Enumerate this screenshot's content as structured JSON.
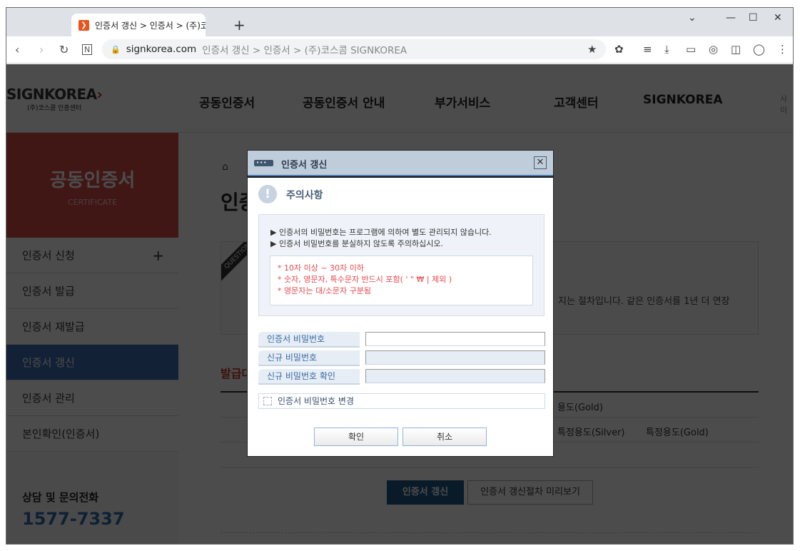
{
  "browser": {
    "tab_title": "인증서 갱신 > 인증서 > (주)코스콤 SIGNKOREA",
    "new_tab": "+",
    "domain": "signkorea.com",
    "path": "인증서 갱신 > 인증서 > (주)코스콤 SIGNKOREA"
  },
  "header": {
    "logo": "SIGNKOREA",
    "logo_sub": "(주)코스콤 인증센터",
    "nav": [
      "공동인증서",
      "공동인증서 안내",
      "부가서비스",
      "고객센터",
      "SIGNKOREA"
    ],
    "extra": "사이"
  },
  "sidebar": {
    "hero_title": "공동인증서",
    "hero_sub": "CERTIFICATE",
    "items": [
      {
        "label": "인증서 신청"
      },
      {
        "label": "인증서 발급"
      },
      {
        "label": "인증서 재발급"
      },
      {
        "label": "인증서 갱신"
      },
      {
        "label": "인증서 관리"
      },
      {
        "label": "본인확인(인증서)"
      }
    ],
    "contact_label": "상담 및 문의전화",
    "contact_tel": "1577-7337"
  },
  "main": {
    "title": "인증",
    "qtag": "QUESTION",
    "desc": "지는 절차입니다. 같은 인증서를 1년 더 연장",
    "subtitle": "발급대",
    "row1": "용도(Gold)",
    "row2a": "특정용도(Silver)",
    "row2b": "특정용도(Gold)",
    "renew_button": "인증서 갱신",
    "preview_button": "인증서 갱신절차 미리보기"
  },
  "dialog": {
    "title": "인증서 갱신",
    "close": "✕",
    "warn_title": "주의사항",
    "notes": [
      "인증서의 비밀번호는 프로그램에 의하여 별도 관리되지 않습니다.",
      "인증서 비밀번호를 분실하지 않도록 주의하십시오."
    ],
    "rules": [
      "* 10자 이상 ~ 30자 이하",
      "* 숫자, 영문자, 특수문자 반드시 포함( ' \" ₩ | 제외 )",
      "* 영문자는 대/소문자 구분됨"
    ],
    "fields": [
      {
        "label": "인증서 비밀번호",
        "value": ""
      },
      {
        "label": "신규 비밀번호",
        "value": ""
      },
      {
        "label": "신규 비밀번호 확인",
        "value": ""
      }
    ],
    "checkbox_label": "인증서 비밀번호 변경",
    "checked": false,
    "ok": "확인",
    "cancel": "취소"
  }
}
